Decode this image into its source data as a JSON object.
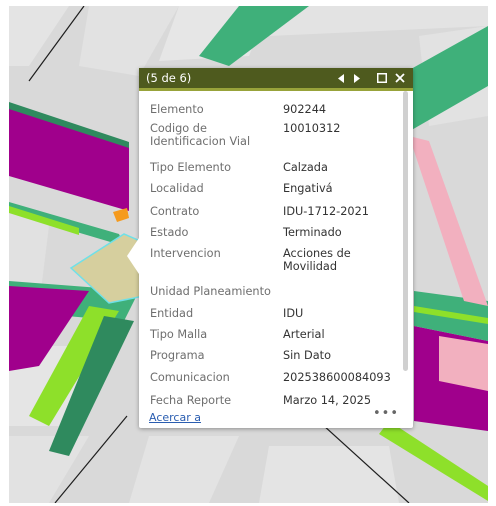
{
  "popup": {
    "title": "(5 de 6)",
    "icons": {
      "prev": "caret-left-icon",
      "next": "caret-right-icon",
      "maximize": "maximize-icon",
      "close": "close-icon"
    },
    "fields": [
      {
        "label": "Elemento",
        "value": "902244"
      },
      {
        "label": "Codigo de Identificacion Vial",
        "value": "10010312"
      },
      {
        "label": "Tipo Elemento",
        "value": "Calzada"
      },
      {
        "label": "Localidad",
        "value": "Engativá"
      },
      {
        "label": "Contrato",
        "value": "IDU-1712-2021"
      },
      {
        "label": "Estado",
        "value": "Terminado"
      },
      {
        "label": "Intervencion",
        "value": "Acciones de Movilidad"
      },
      {
        "label": "Unidad Planeamiento",
        "value": ""
      },
      {
        "label": "Entidad",
        "value": "IDU"
      },
      {
        "label": "Tipo Malla",
        "value": "Arterial"
      },
      {
        "label": "Programa",
        "value": "Sin Dato"
      },
      {
        "label": "Comunicacion",
        "value": "202538600084093"
      },
      {
        "label": "Fecha Reporte",
        "value": "Marzo 14, 2025"
      }
    ],
    "zoom_link": "Acercar a",
    "more": "•••"
  },
  "colors": {
    "header_bg": "#4e5a1e",
    "header_accent": "#98a33a",
    "road_green": "#3fb07a",
    "road_dark_green": "#2f8a5e",
    "magenta": "#a0008c",
    "lime": "#8ee02a",
    "selected_fill": "#d6cf9e",
    "selected_outline": "#6fe0e8",
    "pink": "#f2b0bf",
    "orange": "#f59a1d",
    "building_gray": "#e2e2e2"
  }
}
